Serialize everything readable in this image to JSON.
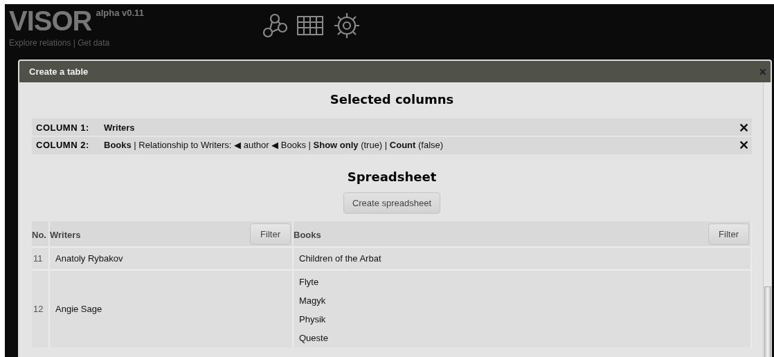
{
  "header": {
    "logo": "VISOR",
    "version": "alpha v0.11",
    "subtitle": "Explore relations | Get data"
  },
  "dialog": {
    "title": "Create a table",
    "close": "×",
    "selected_heading": "Selected columns",
    "columns": [
      {
        "label": "COLUMN 1:",
        "text": "**Writers**",
        "remove": "✕"
      },
      {
        "label": "COLUMN 2:",
        "text": "**Books** | Relationship to Writers: ◀ author ◀ Books | **Show only** (true) | **Count** (false)",
        "remove": "✕"
      }
    ],
    "spreadsheet_heading": "Spreadsheet",
    "create_button": "Create spreadsheet",
    "table": {
      "columns": [
        {
          "label": "No."
        },
        {
          "label": "Writers",
          "filter": "Filter"
        },
        {
          "label": "Books",
          "filter": "Filter"
        }
      ],
      "rows": [
        {
          "no": "11",
          "writer": "Anatoly Rybakov",
          "books": [
            "Children of the Arbat"
          ]
        },
        {
          "no": "12",
          "writer": "Angie Sage",
          "books": [
            "Flyte",
            "Magyk",
            "Physik",
            "Queste"
          ]
        }
      ]
    }
  }
}
